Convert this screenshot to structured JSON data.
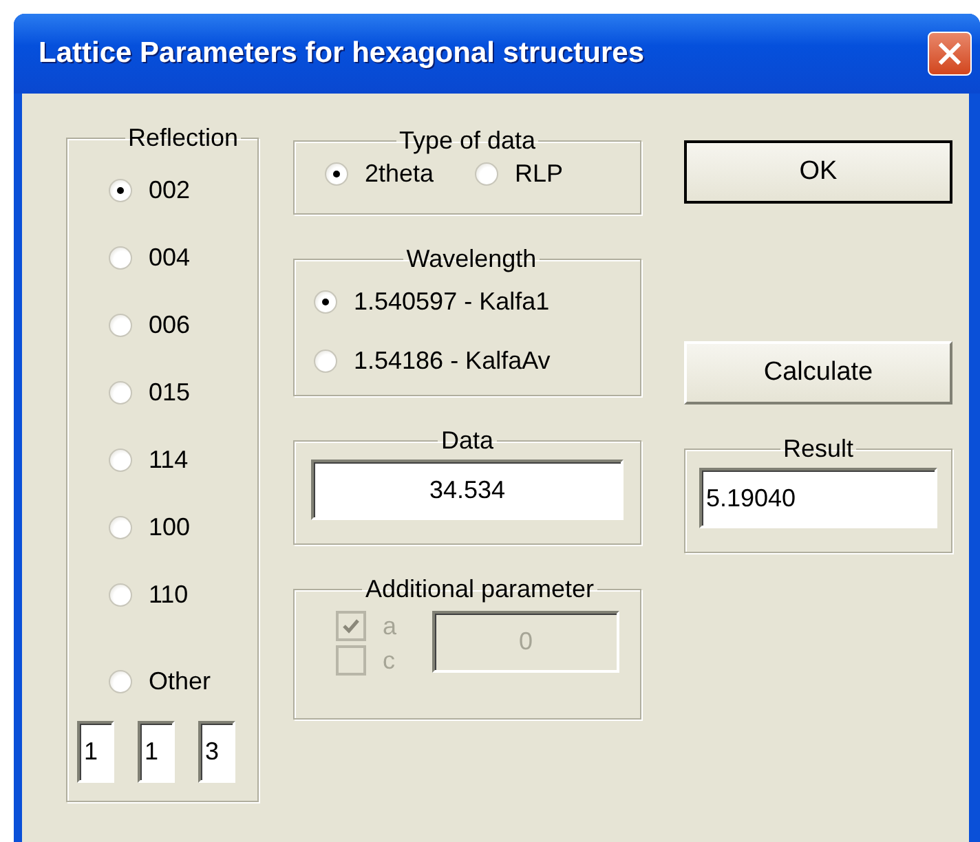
{
  "window": {
    "title": "Lattice Parameters for hexagonal structures"
  },
  "reflection": {
    "label": "Reflection",
    "options": [
      {
        "label": "002",
        "selected": true
      },
      {
        "label": "004",
        "selected": false
      },
      {
        "label": "006",
        "selected": false
      },
      {
        "label": "015",
        "selected": false
      },
      {
        "label": "114",
        "selected": false
      },
      {
        "label": "100",
        "selected": false
      },
      {
        "label": "110",
        "selected": false
      },
      {
        "label": "Other",
        "selected": false
      }
    ],
    "indices": [
      "1",
      "1",
      "3"
    ]
  },
  "type_of_data": {
    "label": "Type of data",
    "options": [
      {
        "label": "2theta",
        "selected": true
      },
      {
        "label": "RLP",
        "selected": false
      }
    ]
  },
  "wavelength": {
    "label": "Wavelength",
    "options": [
      {
        "label": "1.540597 - Kalfa1",
        "selected": true
      },
      {
        "label": "1.54186 - KalfaAv",
        "selected": false
      }
    ]
  },
  "data": {
    "label": "Data",
    "value": "34.534"
  },
  "additional_parameter": {
    "label": "Additional parameter",
    "disabled": true,
    "checkboxes": [
      {
        "label": "a",
        "checked": true
      },
      {
        "label": "c",
        "checked": false
      }
    ],
    "value": "0"
  },
  "buttons": [
    {
      "label": "OK",
      "default": true
    },
    {
      "label": "Calculate",
      "default": false
    }
  ],
  "result": {
    "label": "Result",
    "value": "5.19040"
  }
}
